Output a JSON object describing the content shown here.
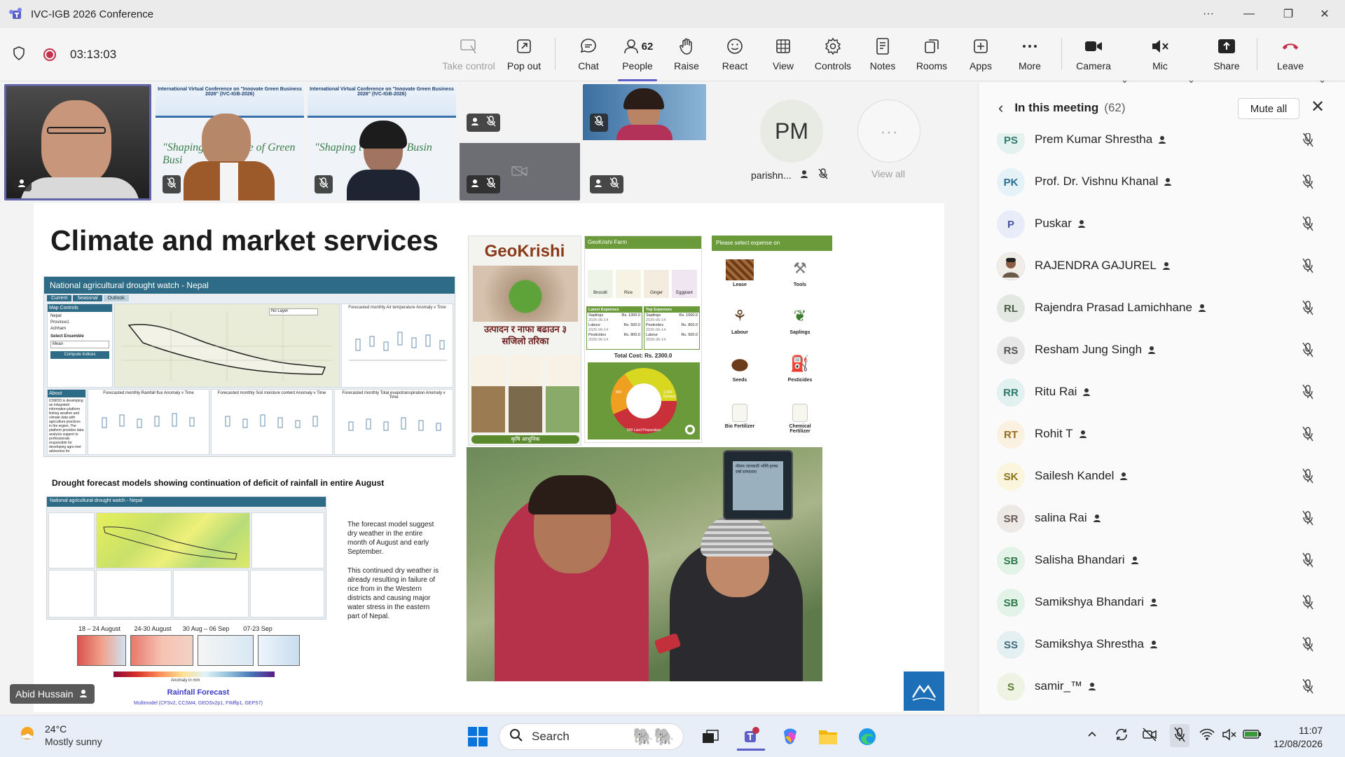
{
  "window": {
    "title": "IVC-IGB 2026 Conference",
    "more": "···",
    "minimize": "—",
    "restore": "❐",
    "close": "✕"
  },
  "toolbar": {
    "timer": "03:13:03",
    "buttons": {
      "take_control": "Take control",
      "pop_out": "Pop out",
      "chat": "Chat",
      "people": "People",
      "people_count": "62",
      "raise": "Raise",
      "react": "React",
      "view": "View",
      "controls": "Controls",
      "notes": "Notes",
      "rooms": "Rooms",
      "apps": "Apps",
      "more": "More",
      "camera": "Camera",
      "mic": "Mic",
      "share": "Share",
      "leave": "Leave"
    }
  },
  "video": {
    "banner_text": "International Virtual Conference on \"Innovate Green Business 2026\" (IVC-IGB-2026)",
    "shaping": "\"Shaping the Future of Green Busi",
    "shaping2": "\"Shaping t       of Green Busin",
    "pm_initials": "PM",
    "pm_name": "parishn...",
    "view_all": "View all",
    "speaker_name": "Abid Hussain"
  },
  "slide": {
    "title": "Climate and market services",
    "drought_header": "National agricultural drought watch - Nepal",
    "tabs": [
      "Current",
      "Seasonal",
      "Outlook"
    ],
    "map_controls": "Map Controls",
    "map_options": [
      "Nepal",
      "Province1",
      "Achham"
    ],
    "ensemble_label": "Select Ensemble",
    "ensemble_value": "Mean",
    "compute_btn": "Compute Indices",
    "layer_select": "No Layer",
    "chart_titles": [
      "Forecasted monthly Air temperature Anomaly v Time",
      "Forecasted monthly Rainfall flux Anomaly v Time",
      "Forecasted monthly Soil moisture content Anomaly v Time",
      "Forecasted monthly Total evapotranspiration Anomaly v Time"
    ],
    "about_title": "About",
    "about_text": "ICIMOD is developing an integrated information platform linking weather and climate data with agriculture practices in the region. The platform provides data analysis support to professionals responsible for developing agro-met advisories for government agencies and farmers. The web-based service",
    "drought_caption": "Drought forecast models showing continuation of deficit of rainfall in entire August",
    "forecast_text1": "The forecast model suggest dry weather in the entire month of August and early September.",
    "forecast_text2": "This continued dry weather is already resulting in failure of rice from in the Western districts and causing major water stress in the eastern part of Nepal.",
    "week_labels": [
      "18 – 24 August",
      "24-30 August",
      "30 Aug – 06 Sep",
      "07-23 Sep"
    ],
    "anomaly_label": "Anomaly in mm",
    "rainfall_forecast": "Rainfall Forecast",
    "multimodel": "Multimodel (CFSv2, CCSM4, GEOSv2p1, FIMflp1, GEPS7)",
    "geokrishi_logo": "GeoKrishi",
    "geokrishi_nepali": "उत्पादन र नाफा बढाउन ३ सजिलो तरिका",
    "geokrishi_bottom": "कृषि आधुनिक",
    "farm_header": "GeoKrishi Farm",
    "crops": [
      "Brocolli",
      "Rice",
      "Ginger",
      "Eggplant"
    ],
    "latest_expenses": "Latest Expenses",
    "top_expenses": "Top Expenses",
    "expense_rows": [
      {
        "name": "Saplings",
        "date": "2026-06-14",
        "amount": "Rs. 1000.0"
      },
      {
        "name": "Labour",
        "date": "2026-06-14",
        "amount": "Rs. 500.0"
      },
      {
        "name": "Pesticides",
        "date": "2026-06-14",
        "amount": "Rs. 800.0"
      }
    ],
    "top_rows": [
      {
        "name": "Saplings",
        "date": "2026-06-14",
        "amount": "Rs. 1000.0"
      },
      {
        "name": "Pesticides",
        "date": "2026-06-14",
        "amount": "Rs. 800.0"
      },
      {
        "name": "Labour",
        "date": "2026-06-14",
        "amount": "Rs. 500.0"
      }
    ],
    "total_cost": "Total Cost: Rs. 2300.0",
    "donut_labels": [
      "1,000 Nursery",
      "500 Land Preparation",
      "800"
    ],
    "expense_header": "Please select expense on",
    "expense_items": [
      "Lease",
      "Tools",
      "Labour",
      "Saplings",
      "Seeds",
      "Pesticides",
      "Bio Fertilizer",
      "Chemical Fertilizer"
    ],
    "phone_text": "मौसम  जानकारी भोलि हल्का वर्षा सम्भावना"
  },
  "panel": {
    "title": "In this meeting",
    "count": "(62)",
    "mute_all": "Mute all",
    "people": [
      {
        "initials": "PS",
        "name": "Prem Kumar Shrestha",
        "bg": "#e3f2ef",
        "fg": "#2f7a6e"
      },
      {
        "initials": "PK",
        "name": "Prof. Dr. Vishnu Khanal",
        "bg": "#e5f2f8",
        "fg": "#2b6f8e"
      },
      {
        "initials": "P",
        "name": "Puskar",
        "bg": "#e8ebf8",
        "fg": "#4a55a3"
      },
      {
        "initials": "",
        "name": "RAJENDRA GAJUREL",
        "bg": "#6b5a4a",
        "fg": "#fff"
      },
      {
        "initials": "RL",
        "name": "Rajendra Prasad Lamichhane",
        "bg": "#e4e8e2",
        "fg": "#4b5a45"
      },
      {
        "initials": "RS",
        "name": "Resham Jung Singh",
        "bg": "#e7e7e7",
        "fg": "#555"
      },
      {
        "initials": "RR",
        "name": "Ritu Rai",
        "bg": "#e1f1ef",
        "fg": "#2f7a6e"
      },
      {
        "initials": "RT",
        "name": "Rohit T",
        "bg": "#fbf1e0",
        "fg": "#9a6a1e"
      },
      {
        "initials": "SK",
        "name": "Sailesh Kandel",
        "bg": "#fbf5dd",
        "fg": "#8a7218"
      },
      {
        "initials": "SR",
        "name": "salina Rai",
        "bg": "#ece9e7",
        "fg": "#6b5d55"
      },
      {
        "initials": "SB",
        "name": "Salisha Bhandari",
        "bg": "#e3f3e8",
        "fg": "#2f7a4a"
      },
      {
        "initials": "SB",
        "name": "Samikshya Bhandari",
        "bg": "#e3f3e8",
        "fg": "#2f7a4a"
      },
      {
        "initials": "SS",
        "name": "Samikshya Shrestha",
        "bg": "#e4eff2",
        "fg": "#3e6b7a"
      },
      {
        "initials": "S",
        "name": "samir_™",
        "bg": "#eef3e3",
        "fg": "#5f7a2f"
      }
    ]
  },
  "taskbar": {
    "temp": "24°C",
    "condition": "Mostly sunny",
    "search": "Search",
    "time": "11:07",
    "date": "12/08/2026"
  },
  "colors": {
    "accent": "#5b5fc7",
    "leave": "#c4314b",
    "record": "#c4314b"
  }
}
